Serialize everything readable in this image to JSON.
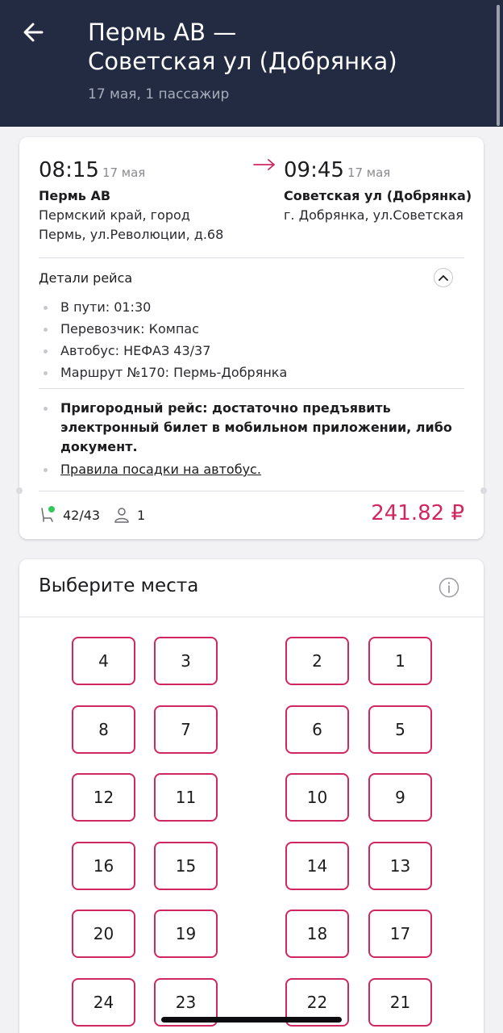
{
  "header": {
    "title_line1": "Пермь АВ —",
    "title_line2": "Советская ул (Добрянка)",
    "subtitle": "17 мая, 1 пассажир",
    "back_icon": "arrow-left-icon"
  },
  "trip": {
    "departure": {
      "time": "08:15",
      "date": "17 мая",
      "station": "Пермь АВ",
      "address_line1": "Пермский край, город",
      "address_line2": "Пермь, ул.Революции, д.68"
    },
    "arrival": {
      "time": "09:45",
      "date": "17 мая",
      "station": "Советская ул (Добрянка)",
      "address_line1": "г. Добрянка, ул.Советская"
    },
    "details_label": "Детали рейса",
    "details": [
      "В пути: 01:30",
      "Перевозчик: Компас",
      "Автобус: НЕФАЗ 43/37",
      "Маршрут №170: Пермь-Добрянка"
    ],
    "notice_line1": "Пригородный рейс: достаточно предъявить",
    "notice_line2": "электронный билет в мобильном приложении, либо",
    "notice_line3": "документ.",
    "rules_link": "Правила посадки на автобус.",
    "seats_available": "42/43",
    "passengers": "1",
    "price": "241.82 ₽"
  },
  "seats_section": {
    "title": "Выберите места",
    "info_icon": "info-icon",
    "rows": [
      [
        "4",
        "3",
        "2",
        "1"
      ],
      [
        "8",
        "7",
        "6",
        "5"
      ],
      [
        "12",
        "11",
        "10",
        "9"
      ],
      [
        "16",
        "15",
        "14",
        "13"
      ],
      [
        "20",
        "19",
        "18",
        "17"
      ],
      [
        "24",
        "23",
        "22",
        "21"
      ]
    ]
  },
  "colors": {
    "header_bg": "#222b41",
    "accent": "#d0285e",
    "available_dot": "#34c759"
  }
}
